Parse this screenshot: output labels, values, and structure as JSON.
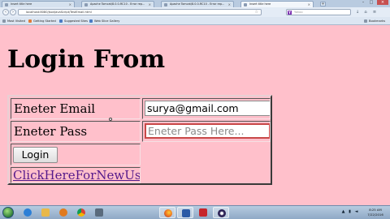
{
  "browser": {
    "tabs": [
      {
        "label": "Insert title here",
        "active": false
      },
      {
        "label": "Apache Tomcat/8.0.0-RC10 - Error rep...",
        "active": false
      },
      {
        "label": "Apache Tomcat/8.0.0-RC10 - Error rep...",
        "active": false
      },
      {
        "label": "Insert title here",
        "active": true
      }
    ],
    "new_tab_label": "+",
    "url": "localhost:8080/JsonJavaScript/TestEmail.html",
    "search_placeholder": "Yahoo",
    "search_logo": "Y",
    "bookmarks": [
      "Most Visited",
      "Getting Started",
      "Suggested Sites",
      "Web Slice Gallery"
    ],
    "bookmarks_menu": "Bookmarks",
    "icons": [
      "back-icon",
      "forward-icon",
      "star-icon",
      "download-icon",
      "home-icon",
      "menu-icon"
    ]
  },
  "page": {
    "heading": "Login From",
    "email_label": "Eneter Email",
    "email_value": "surya@gmail.com",
    "pass_label": "Eneter Pass",
    "pass_placeholder": "Eneter Pass Here...",
    "login_button": "Login",
    "new_user_link": "ClickHereForNewUser"
  },
  "colors": {
    "page_background": "#ffc0cb",
    "link_visited": "#551a8b",
    "invalid_border": "#c84848"
  },
  "taskbar": {
    "apps": [
      "ie-icon",
      "folder-icon",
      "media-player-icon",
      "chrome-icon",
      "app-icon",
      "firefox-icon",
      "word-icon",
      "acrobat-icon",
      "eclipse-icon"
    ],
    "time": "8:25 AM",
    "date": "7/22/2016"
  }
}
